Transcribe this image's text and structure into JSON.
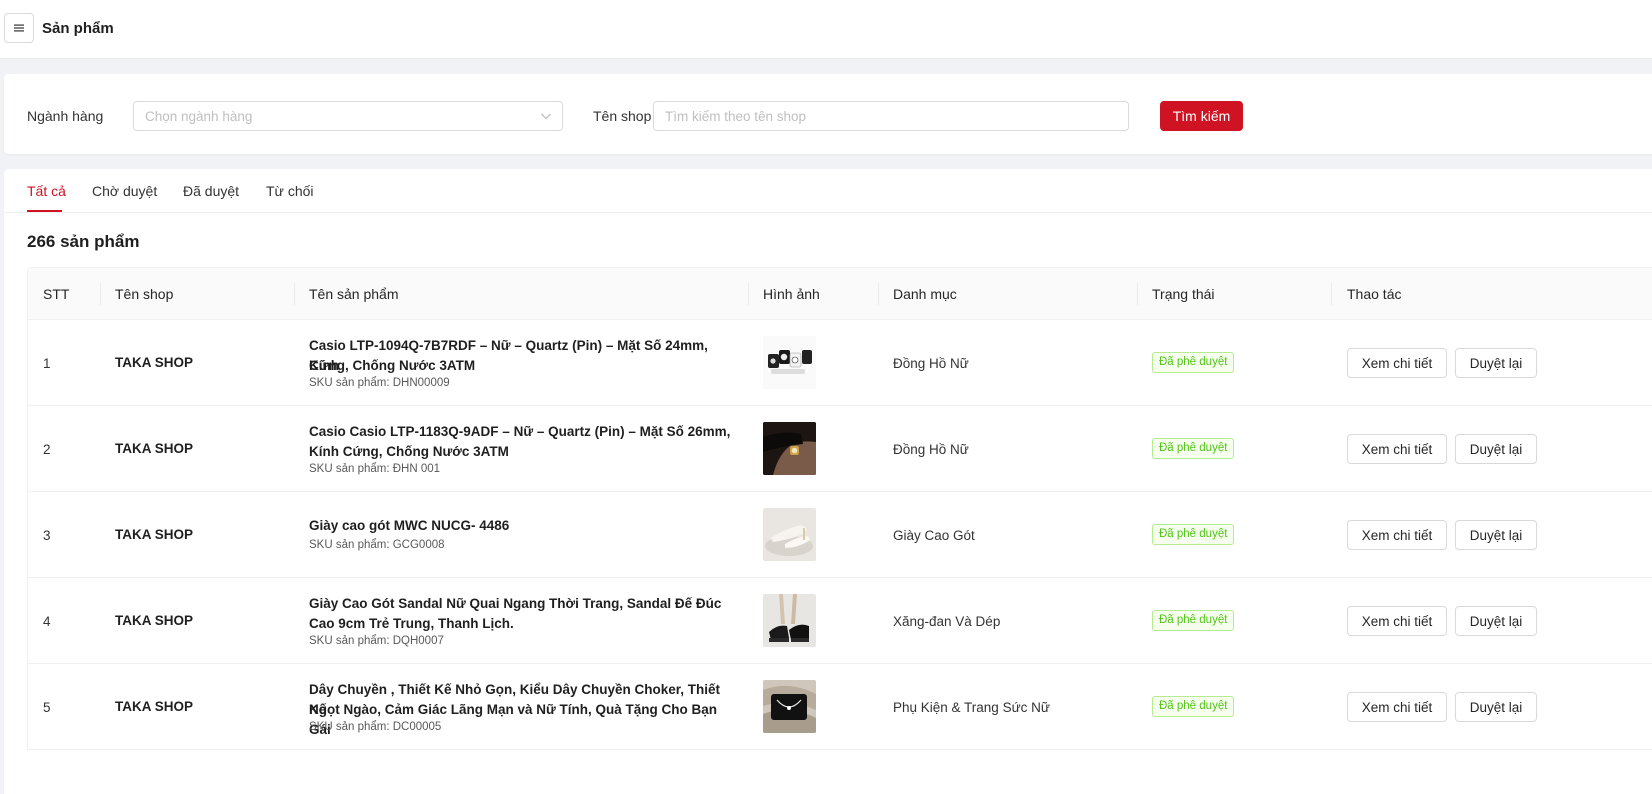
{
  "header": {
    "title": "Sản phẩm",
    "menu_icon": "hamburger-menu-icon"
  },
  "filters": {
    "category_label": "Ngành hàng",
    "category_placeholder": "Chọn ngành hàng",
    "shop_label": "Tên shop",
    "shop_placeholder": "Tìm kiếm theo tên shop",
    "search_button": "Tìm kiếm",
    "accent_color": "#cf1322"
  },
  "tabs": [
    {
      "label": "Tất cả",
      "active": true
    },
    {
      "label": "Chờ duyệt",
      "active": false
    },
    {
      "label": "Đã duyệt",
      "active": false
    },
    {
      "label": "Từ chối",
      "active": false
    }
  ],
  "summary": {
    "count_text": "266 sản phẩm"
  },
  "table": {
    "columns": [
      "STT",
      "Tên shop",
      "Tên sản phẩm",
      "Hình ảnh",
      "Danh mục",
      "Trạng thái",
      "Thao tác"
    ],
    "actions": {
      "view": "Xem chi tiết",
      "reapprove": "Duyệt lại"
    },
    "rows": [
      {
        "stt": "1",
        "shop": "TAKA SHOP",
        "name_lines": [
          "Casio LTP-1094Q-7B7RDF – Nữ – Quartz (Pin) – Mặt Số 24mm, Kính",
          "Cứng, Chống Nước 3ATM"
        ],
        "sku": "SKU sản phẩm: DHN00009",
        "image": "watch-set-thumbnail",
        "category": "Đồng Hồ Nữ",
        "status": "Đã phê duyệt"
      },
      {
        "stt": "2",
        "shop": "TAKA SHOP",
        "name_lines": [
          "Casio Casio LTP-1183Q-9ADF – Nữ – Quartz (Pin) – Mặt Số 26mm,",
          "Kính Cứng, Chống Nước 3ATM"
        ],
        "sku": "SKU sản phẩm: ĐHN 001",
        "image": "wrist-watch-thumbnail",
        "category": "Đồng Hồ Nữ",
        "status": "Đã phê duyệt"
      },
      {
        "stt": "3",
        "shop": "TAKA SHOP",
        "name_lines": [
          "Giày cao gót MWC NUCG- 4486"
        ],
        "sku": "SKU sản phẩm: GCG0008",
        "image": "high-heels-thumbnail",
        "category": "Giày Cao Gót",
        "status": "Đã phê duyệt"
      },
      {
        "stt": "4",
        "shop": "TAKA SHOP",
        "name_lines": [
          "Giày Cao Gót Sandal Nữ Quai Ngang Thời Trang, Sandal Đế Đúc",
          "Cao 9cm Trẻ Trung, Thanh Lịch."
        ],
        "sku": "SKU sản phẩm: DQH0007",
        "image": "sandal-thumbnail",
        "category": "Xăng-đan Và Dép",
        "status": "Đã phê duyệt"
      },
      {
        "stt": "5",
        "shop": "TAKA SHOP",
        "name_lines": [
          "Dây Chuyền , Thiết Kế Nhỏ Gọn, Kiểu Dây Chuyền Choker, Thiết Kế",
          "Ngọt Ngào, Cảm Giác Lãng Mạn và Nữ Tính, Quà Tặng Cho Bạn Gái"
        ],
        "sku": "SKU sản phẩm: DC00005",
        "image": "necklace-thumbnail",
        "category": "Phụ Kiện & Trang Sức Nữ",
        "status": "Đã phê duyệt"
      }
    ]
  }
}
